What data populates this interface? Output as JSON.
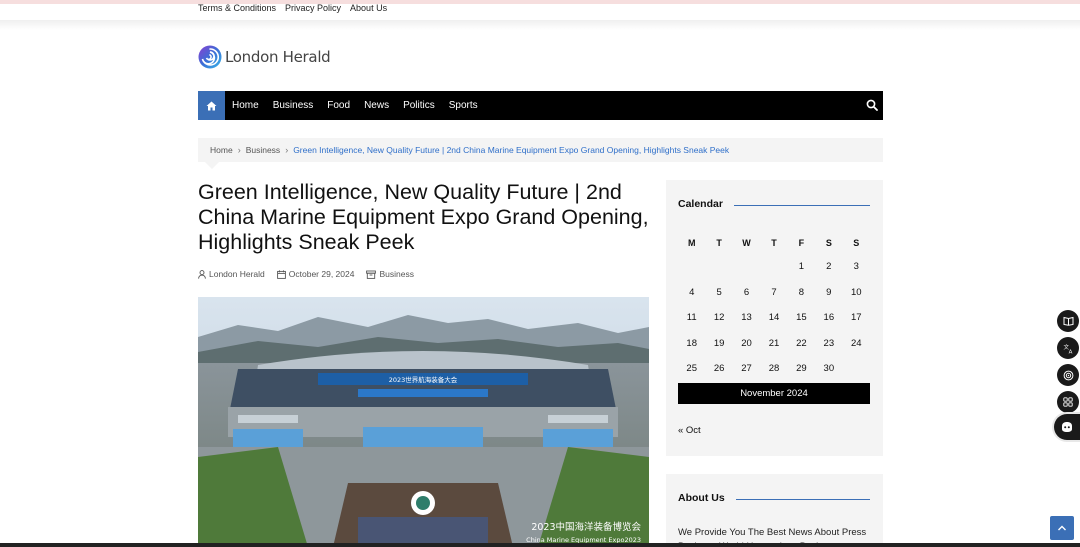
{
  "top_links": [
    "Terms & Conditions",
    "Privacy Policy",
    "About Us"
  ],
  "site": {
    "name": "London Herald",
    "accent": "#3b6fb6"
  },
  "nav": {
    "home_icon": "home-icon",
    "items": [
      "Home",
      "Business",
      "Food",
      "News",
      "Politics",
      "Sports"
    ],
    "search_icon": "search-icon"
  },
  "breadcrumb": {
    "home": "Home",
    "section": "Business",
    "current": "Green Intelligence, New Quality Future | 2nd China Marine Equipment Expo Grand Opening, Highlights Sneak Peek"
  },
  "article": {
    "title": "Green Intelligence, New Quality Future | 2nd China Marine Equipment Expo Grand Opening, Highlights Sneak Peek",
    "author": "London Herald",
    "date": "October 29, 2024",
    "category": "Business",
    "image_caption": "2023中国海洋装备博览会",
    "image_caption_en": "China Marine Equipment Expo2023",
    "banner_text": "2023世界航海装备大会"
  },
  "calendar": {
    "title": "Calendar",
    "weekdays": [
      "M",
      "T",
      "W",
      "T",
      "F",
      "S",
      "S"
    ],
    "weeks": [
      [
        "",
        "",
        "",
        "",
        "1",
        "2",
        "3"
      ],
      [
        "4",
        "5",
        "6",
        "7",
        "8",
        "9",
        "10"
      ],
      [
        "11",
        "12",
        "13",
        "14",
        "15",
        "16",
        "17"
      ],
      [
        "18",
        "19",
        "20",
        "21",
        "22",
        "23",
        "24"
      ],
      [
        "25",
        "26",
        "27",
        "28",
        "29",
        "30",
        ""
      ]
    ],
    "month_label": "November 2024",
    "prev_link": "« Oct"
  },
  "about": {
    "title": "About Us",
    "text": "We Provide You The Best News About Press Business World Happenings Business"
  },
  "side_tools": [
    "book-icon",
    "translate-icon",
    "target-icon",
    "grid-icon",
    "assistant-icon"
  ]
}
